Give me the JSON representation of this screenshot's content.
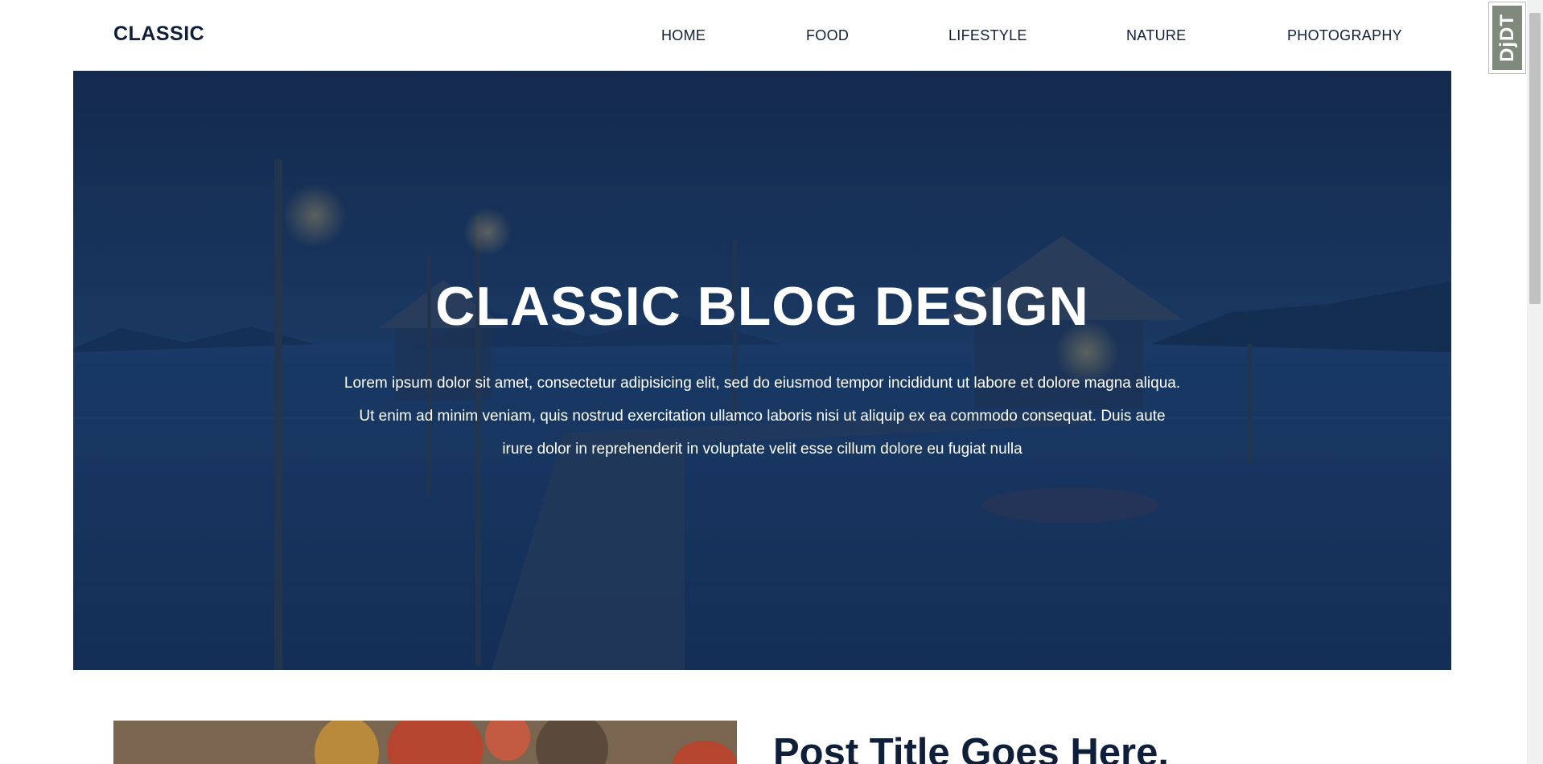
{
  "header": {
    "logo": "CLASSIC",
    "nav": [
      "HOME",
      "FOOD",
      "LIFESTYLE",
      "NATURE",
      "PHOTOGRAPHY"
    ]
  },
  "hero": {
    "title": "CLASSIC BLOG DESIGN",
    "text": "Lorem ipsum dolor sit amet, consectetur adipisicing elit, sed do eiusmod tempor incididunt ut labore et dolore magna aliqua. Ut enim ad minim veniam, quis nostrud exercitation ullamco laboris nisi ut aliquip ex ea commodo consequat. Duis aute irure dolor in reprehenderit in voluptate velit esse cillum dolore eu fugiat nulla"
  },
  "post": {
    "title": "Post Title Goes Here."
  },
  "debug_toolbar": {
    "label": "DjDT"
  },
  "colors": {
    "text_dark": "#0f1f3a",
    "hero_overlay": "#1d3760"
  }
}
